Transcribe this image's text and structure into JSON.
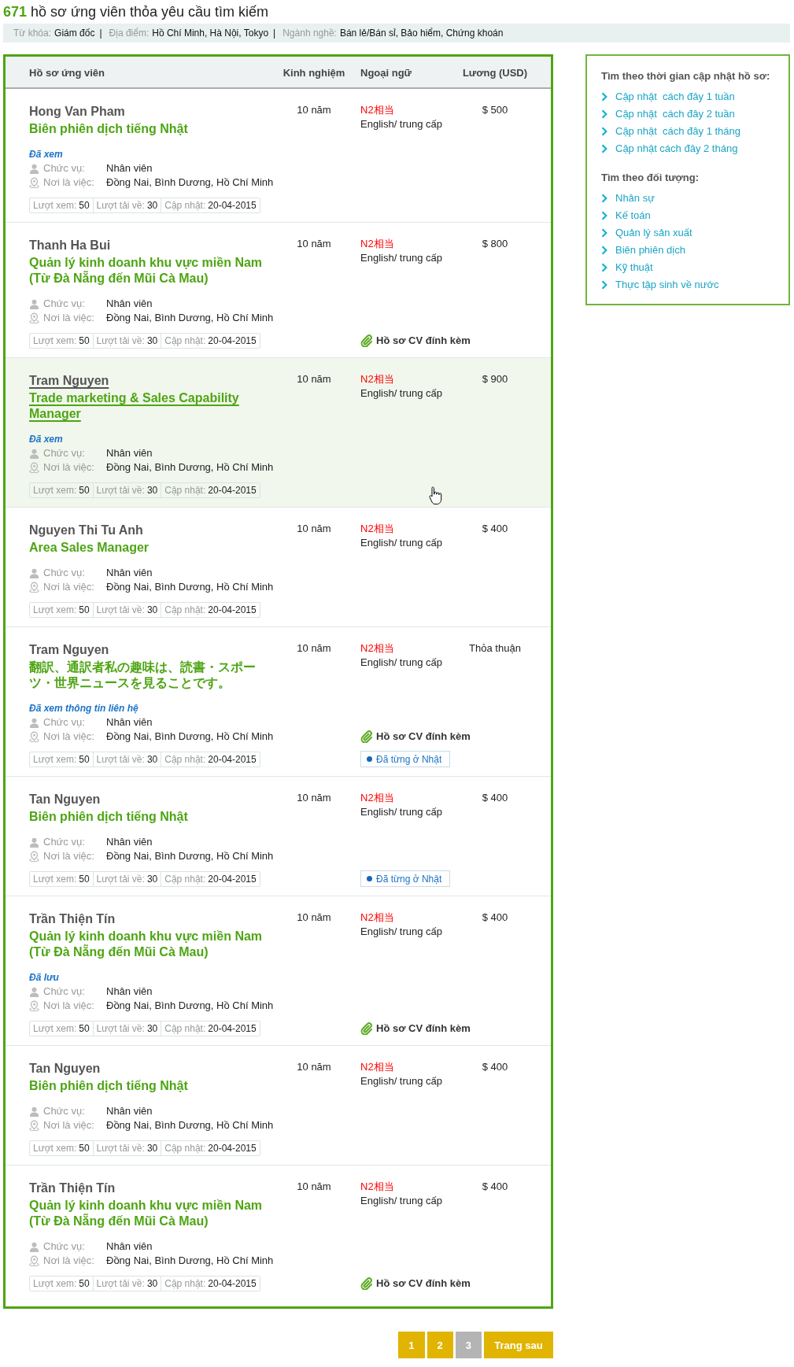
{
  "heading": "**671** hồ sơ ứng viên thỏa yêu cầu tìm kiếm",
  "filters": [
    {
      "label": "Từ khóa:",
      "value": "Giám đốc",
      "separator": "|"
    },
    {
      "label": "Địa điểm:",
      "value": "Hồ Chí Minh, Hà Nội, Tokyo",
      "separator": "|"
    },
    {
      "label": "Ngành nghề:",
      "value": "Bán lẻ/Bán sỉ, Bảo hiểm, Chứng khoán"
    }
  ],
  "table": {
    "columns": [
      "Hồ sơ ứng viên",
      "Kinh nghiệm",
      "Ngoại ngữ",
      "Lương (USD)"
    ],
    "rows": [
      {
        "name": "Hong Van Pham",
        "title": "Biên phiên dịch tiếng Nhật",
        "status": "Đã xem",
        "details": [
          {
            "kind": "position",
            "label": "Chức vụ:",
            "value": "Nhân viên"
          },
          {
            "kind": "location",
            "label": "Nơi là việc:",
            "value": "Đồng Nai, Bình Dương, Hồ Chí Minh"
          }
        ],
        "stats": [
          {
            "label": "Lượt xem:",
            "value": "50"
          },
          {
            "label": "Lượt tải về:",
            "value": "30"
          },
          {
            "label": "Cập nhật:",
            "value": "20-04-2015"
          }
        ],
        "experience": "10 năm",
        "japanese_level": "N2相当",
        "other_language": "English/ trung cấp",
        "salary": "$ 500",
        "hovered": false
      },
      {
        "name": "Thanh Ha Bui",
        "title": "Quản lý kinh doanh khu vực miền Nam (Từ Đà Nẵng đến Mũi Cà Mau)",
        "details": [
          {
            "kind": "position",
            "label": "Chức vụ:",
            "value": "Nhân viên"
          },
          {
            "kind": "location",
            "label": "Nơi là việc:",
            "value": "Đồng Nai, Bình Dương, Hồ Chí Minh"
          }
        ],
        "stats": [
          {
            "label": "Lượt xem:",
            "value": "50"
          },
          {
            "label": "Lượt tải về:",
            "value": "30"
          },
          {
            "label": "Cập nhật:",
            "value": "20-04-2015"
          }
        ],
        "experience": "10 năm",
        "japanese_level": "N2相当",
        "other_language": "English/ trung cấp",
        "salary": "$ 800",
        "attachment": "Hồ sơ CV đính kèm",
        "hovered": false
      },
      {
        "name": "Tram Nguyen",
        "title": "Trade marketing & Sales Capability Manager",
        "status": "Đã xem",
        "details": [
          {
            "kind": "position",
            "label": "Chức vụ:",
            "value": "Nhân viên"
          },
          {
            "kind": "location",
            "label": "Nơi là việc:",
            "value": "Đồng Nai, Bình Dương, Hồ Chí Minh"
          }
        ],
        "stats": [
          {
            "label": "Lượt xem:",
            "value": "50"
          },
          {
            "label": "Lượt tải về:",
            "value": "30"
          },
          {
            "label": "Cập nhật:",
            "value": "20-04-2015"
          }
        ],
        "experience": "10 năm",
        "japanese_level": "N2相当",
        "other_language": "English/ trung cấp",
        "salary": "$ 900",
        "hovered": true
      },
      {
        "name": "Nguyen Thi Tu Anh",
        "title": "Area Sales Manager",
        "details": [
          {
            "kind": "position",
            "label": "Chức vụ:",
            "value": "Nhân viên"
          },
          {
            "kind": "location",
            "label": "Nơi là việc:",
            "value": "Đồng Nai, Bình Dương, Hồ Chí Minh"
          }
        ],
        "stats": [
          {
            "label": "Lượt xem:",
            "value": "50"
          },
          {
            "label": "Lượt tải về:",
            "value": "30"
          },
          {
            "label": "Cập nhật:",
            "value": "20-04-2015"
          }
        ],
        "experience": "10 năm",
        "japanese_level": "N2相当",
        "other_language": "English/ trung cấp",
        "salary": "$ 400",
        "hovered": false
      },
      {
        "name": "Tram Nguyen",
        "title": "翻訳、通訳者私の趣味は、読書・スポーツ・世界ニュースを見ることです。",
        "status": "Đã xem thông tin liên hệ",
        "details": [
          {
            "kind": "position",
            "label": "Chức vụ:",
            "value": "Nhân viên"
          },
          {
            "kind": "location",
            "label": "Nơi là việc:",
            "value": "Đồng Nai, Bình Dương, Hồ Chí Minh"
          }
        ],
        "stats": [
          {
            "label": "Lượt xem:",
            "value": "50"
          },
          {
            "label": "Lượt tải về:",
            "value": "30"
          },
          {
            "label": "Cập nhật:",
            "value": "20-04-2015"
          }
        ],
        "experience": "10 năm",
        "japanese_level": "N2相当",
        "other_language": "English/ trung cấp",
        "salary": "Thỏa thuận",
        "attachment": "Hồ sơ CV đính kèm",
        "badge": "Đã từng ở Nhật",
        "hovered": false
      },
      {
        "name": "Tan Nguyen",
        "title": "Biên phiên dịch tiếng Nhật",
        "details": [
          {
            "kind": "position",
            "label": "Chức vụ:",
            "value": "Nhân viên"
          },
          {
            "kind": "location",
            "label": "Nơi là việc:",
            "value": "Đồng Nai, Bình Dương, Hồ Chí Minh"
          }
        ],
        "stats": [
          {
            "label": "Lượt xem:",
            "value": "50"
          },
          {
            "label": "Lượt tải về:",
            "value": "30"
          },
          {
            "label": "Cập nhật:",
            "value": "20-04-2015"
          }
        ],
        "experience": "10 năm",
        "japanese_level": "N2相当",
        "other_language": "English/ trung cấp",
        "salary": "$ 400",
        "badge": "Đã từng ở Nhật",
        "hovered": false
      },
      {
        "name": "Trần Thiện Tín",
        "title": "Quản lý kinh doanh khu vực miền Nam (Từ Đà Nẵng đến Mũi Cà Mau)",
        "status": "Đã lưu",
        "details": [
          {
            "kind": "position",
            "label": "Chức vụ:",
            "value": "Nhân viên"
          },
          {
            "kind": "location",
            "label": "Nơi là việc:",
            "value": "Đồng Nai, Bình Dương, Hồ Chí Minh"
          }
        ],
        "stats": [
          {
            "label": "Lượt xem:",
            "value": "50"
          },
          {
            "label": "Lượt tải về:",
            "value": "30"
          },
          {
            "label": "Cập nhật:",
            "value": "20-04-2015"
          }
        ],
        "experience": "10 năm",
        "japanese_level": "N2相当",
        "other_language": "English/ trung cấp",
        "salary": "$ 400",
        "attachment": "Hồ sơ CV đính kèm",
        "hovered": false
      },
      {
        "name": "Tan Nguyen",
        "title": "Biên phiên dịch tiếng Nhật",
        "details": [
          {
            "kind": "position",
            "label": "Chức vụ:",
            "value": "Nhân viên"
          },
          {
            "kind": "location",
            "label": "Nơi là việc:",
            "value": "Đồng Nai, Bình Dương, Hồ Chí Minh"
          }
        ],
        "stats": [
          {
            "label": "Lượt xem:",
            "value": "50"
          },
          {
            "label": "Lượt tải về:",
            "value": "30"
          },
          {
            "label": "Cập nhật:",
            "value": "20-04-2015"
          }
        ],
        "experience": "10 năm",
        "japanese_level": "N2相当",
        "other_language": "English/ trung cấp",
        "salary": "$ 400",
        "hovered": false
      },
      {
        "name": "Trần Thiện Tín",
        "title": "Quản lý kinh doanh khu vực miền Nam (Từ Đà Nẵng đến Mũi Cà Mau)",
        "details": [
          {
            "kind": "position",
            "label": "Chức vụ:",
            "value": "Nhân viên"
          },
          {
            "kind": "location",
            "label": "Nơi là việc:",
            "value": "Đồng Nai, Bình Dương, Hồ Chí Minh"
          }
        ],
        "stats": [
          {
            "label": "Lượt xem:",
            "value": "50"
          },
          {
            "label": "Lượt tải về:",
            "value": "30"
          },
          {
            "label": "Cập nhật:",
            "value": "20-04-2015"
          }
        ],
        "experience": "10 năm",
        "japanese_level": "N2相当",
        "other_language": "English/ trung cấp",
        "salary": "$ 400",
        "attachment": "Hồ sơ CV đính kèm",
        "hovered": false
      }
    ]
  },
  "sidebar": {
    "sections": [
      {
        "title": "Tìm theo thời gian cập nhật hồ sơ:",
        "items": [
          "Cập nhật  cách đây 1 tuần",
          "Cập nhật  cách đây 2 tuần",
          "Cập nhật  cách đây 1 tháng",
          "Cập nhật cách đây 2 tháng"
        ]
      },
      {
        "title": "Tìm theo đối tượng:",
        "items": [
          "Nhân sự",
          "Kế toán",
          "Quản lý sản xuất",
          "Biên phiên dịch",
          "Kỹ thuật",
          "Thực tập sinh về nước"
        ]
      }
    ]
  },
  "pagination": {
    "pages": [
      {
        "label": "1",
        "selected": false
      },
      {
        "label": "2",
        "selected": false
      },
      {
        "label": "3",
        "selected": true
      }
    ],
    "next": "Trang sau"
  }
}
